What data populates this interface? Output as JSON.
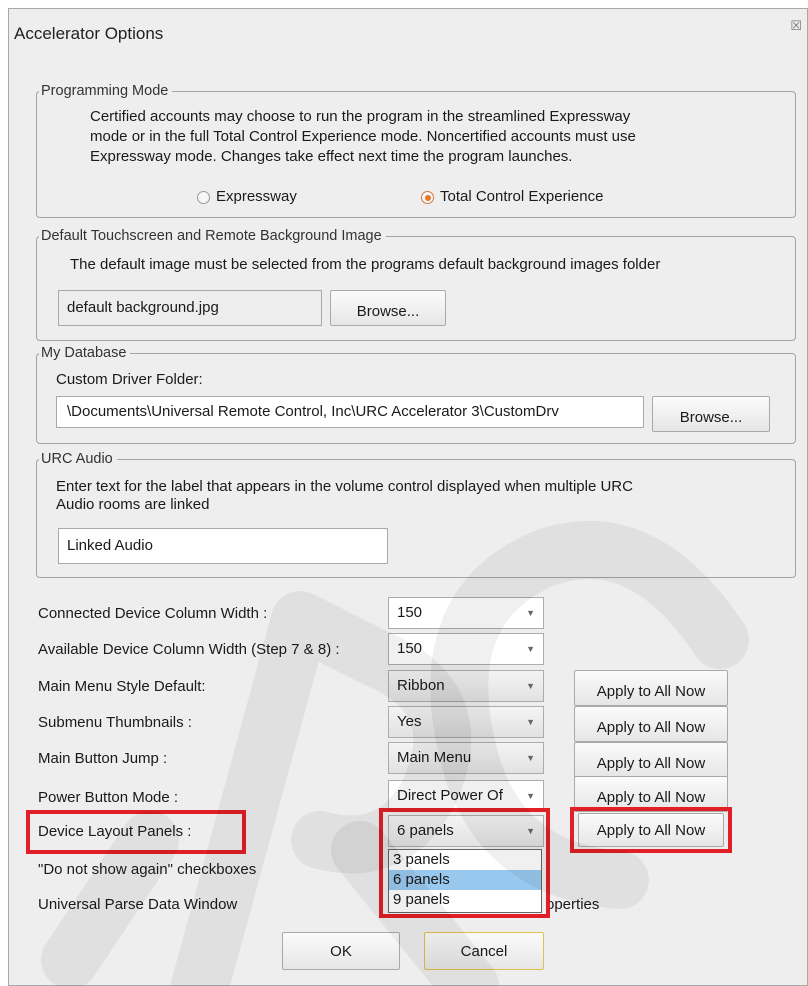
{
  "window": {
    "title": "Accelerator Options",
    "close_glyph": "☒",
    "close_icon": "close-icon"
  },
  "programming_mode": {
    "legend": "Programming Mode",
    "desc_lines": [
      "Certified accounts may choose to run the program in the streamlined Expressway",
      "mode or in the full Total Control Experience mode. Noncertified accounts must use",
      "Expressway mode. Changes take effect next time the program launches."
    ],
    "options": [
      {
        "label": "Expressway",
        "selected": false
      },
      {
        "label": "Total Control Experience",
        "selected": true
      }
    ]
  },
  "default_background": {
    "legend": "Default Touchscreen and Remote Background Image",
    "desc": "The default image must be selected from the programs default background images folder",
    "file_value": "default background.jpg",
    "browse_label": "Browse..."
  },
  "my_database": {
    "legend": "My Database",
    "folder_label": "Custom Driver Folder:",
    "folder_value": "\\Documents\\Universal Remote Control, Inc\\URC Accelerator 3\\CustomDrv",
    "browse_label": "Browse..."
  },
  "urc_audio": {
    "legend": "URC Audio",
    "desc_lines": [
      "Enter text for the label that appears in the volume control displayed when multiple URC",
      "Audio rooms are linked"
    ],
    "label_value": "Linked Audio"
  },
  "settings": {
    "connected_col": {
      "label": "Connected Device Column Width :",
      "value": "150"
    },
    "available_col": {
      "label": "Available Device Column Width (Step 7 & 8) :",
      "value": "150"
    },
    "main_menu_style": {
      "label": "Main Menu Style Default:",
      "value": "Ribbon",
      "apply": "Apply to All Now"
    },
    "submenu_thumbs": {
      "label": "Submenu Thumbnails :",
      "value": "Yes",
      "apply": "Apply to All Now"
    },
    "main_button_jump": {
      "label": "Main Button Jump :",
      "value": "Main Menu",
      "apply": "Apply to All Now"
    },
    "power_button_mode": {
      "label": "Power Button Mode :",
      "value": "Direct Power Of",
      "apply": "Apply to All Now"
    },
    "device_layout": {
      "label": "Device Layout Panels :",
      "value": "6 panels",
      "apply": "Apply to All Now",
      "options": [
        "3 panels",
        "6 panels",
        "9 panels"
      ],
      "highlighted_index": 1
    },
    "do_not_show": {
      "label": "\"Do not show again\" checkboxes"
    },
    "parse_window": {
      "label": "Universal Parse Data Window",
      "trailing_text": "operties"
    }
  },
  "footer": {
    "ok": "OK",
    "cancel": "Cancel"
  },
  "colors": {
    "highlight_red": "#e01f26",
    "radio_orange": "#e3762c",
    "list_highlight": "#99c8ef",
    "watermark": "#000000"
  },
  "icons": {
    "dropdown_arrow": "▼"
  }
}
